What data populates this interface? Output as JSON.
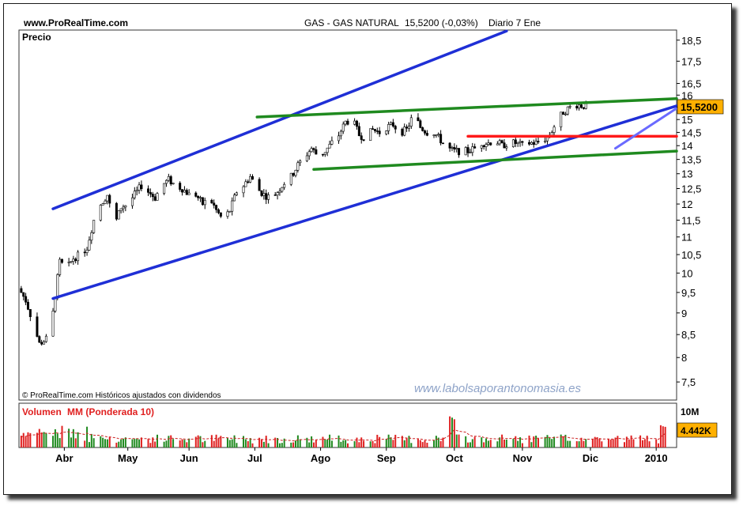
{
  "header": {
    "site": "www.ProRealTime.com",
    "instrument": "GAS - GAS NATURAL",
    "quote": "15,5200 (-0,03%)",
    "period": "Diario  7 Ene"
  },
  "price_panel": {
    "label": "Precio",
    "footer": "© ProRealTime.com  Históricos ajustados con dividendos",
    "watermark": "www.labolsaporantonomasia.es",
    "last_price_badge": "15,5200"
  },
  "volume_panel": {
    "label_volume": "Volumen",
    "label_mm": "MM (Ponderada 10)",
    "scale_max_label": "10M",
    "last_volume_badge": "4.442K"
  },
  "colors": {
    "channel": "#1f2fd6",
    "support_resistance": "#1f8a1f",
    "horizontal_level": "#ff1a1a",
    "short_trend": "#6a6aff",
    "candles": "#000000",
    "volume_up": "#1f8a1f",
    "volume_down": "#e02020",
    "volume_ma": "#cc2222",
    "badge_bg": "#ffb000"
  },
  "chart_data": {
    "type": "line",
    "title": "GAS - GAS NATURAL",
    "x_axis": {
      "labels": [
        "Abr",
        "May",
        "Jun",
        "Jul",
        "Ago",
        "Sep",
        "Oct",
        "Nov",
        "Dic",
        "2010"
      ],
      "label_positions_in_days": [
        5,
        33,
        60,
        89,
        118,
        147,
        177,
        207,
        237,
        266
      ],
      "range_days": [
        -15,
        275
      ]
    },
    "y_axis": {
      "ticks": [
        7.5,
        8,
        8.5,
        9,
        9.5,
        10,
        10.5,
        11,
        11.5,
        12,
        12.5,
        13,
        13.5,
        14,
        14.5,
        15,
        15.5,
        16,
        16.5,
        17.5,
        18.5
      ],
      "tick_labels": [
        "7,5",
        "8",
        "8,5",
        "9",
        "9,5",
        "10",
        "10,5",
        "11",
        "11,5",
        "12",
        "12,5",
        "13",
        "13,5",
        "14",
        "14,5",
        "15",
        "15,5",
        "16",
        "16,5",
        "17,5",
        "18,5"
      ],
      "scale": "log",
      "range": [
        7.15,
        19.0
      ]
    },
    "price_series": {
      "name": "Precio",
      "x_days": [
        -15,
        -12,
        -9,
        -6,
        -3,
        0,
        3,
        6,
        9,
        12,
        15,
        18,
        21,
        24,
        27,
        30,
        33,
        36,
        39,
        42,
        45,
        48,
        51,
        54,
        57,
        60,
        63,
        66,
        69,
        72,
        75,
        78,
        81,
        84,
        87,
        90,
        93,
        96,
        99,
        102,
        105,
        108,
        111,
        114,
        117,
        120,
        123,
        126,
        129,
        132,
        135,
        138,
        141,
        144,
        147,
        150,
        153,
        156,
        159,
        162,
        165,
        168,
        171,
        174,
        177,
        180,
        183,
        186,
        189,
        192,
        195,
        198,
        201,
        204,
        207,
        210,
        213,
        216,
        219,
        222,
        225,
        228,
        231,
        234,
        237,
        240,
        243,
        246,
        249,
        252,
        255,
        258,
        261,
        264,
        267,
        270
      ],
      "close": [
        9.6,
        9.3,
        8.8,
        8.3,
        8.4,
        9.0,
        10.3,
        10.1,
        10.4,
        10.5,
        10.7,
        11.5,
        12.0,
        12.3,
        11.3,
        11.9,
        12.0,
        12.3,
        12.6,
        12.4,
        12.2,
        12.6,
        12.8,
        12.6,
        12.5,
        12.3,
        12.3,
        12.0,
        12.2,
        11.8,
        11.5,
        11.8,
        12.4,
        12.6,
        12.9,
        12.5,
        12.3,
        12.2,
        12.4,
        12.7,
        12.9,
        13.3,
        13.6,
        13.9,
        13.6,
        13.8,
        14.1,
        14.4,
        14.9,
        15.0,
        14.4,
        14.3,
        14.6,
        14.5,
        14.7,
        14.8,
        14.5,
        14.6,
        15.2,
        14.7,
        14.5,
        14.5,
        14.2,
        13.9,
        13.8,
        13.8,
        13.8,
        13.9,
        14.1,
        14.1,
        14.2,
        14.0,
        14.1,
        14.1,
        14.0,
        14.1,
        14.1,
        14.2,
        14.4,
        14.9,
        15.3,
        15.5,
        15.6,
        15.55,
        15.52
      ],
      "note_values": "approximate daily closes read from candlestick chart"
    },
    "trendlines": [
      {
        "name": "canal alcista superior",
        "color": "channel",
        "points": [
          [
            0,
            11.85
          ],
          [
            200,
            18.95
          ]
        ]
      },
      {
        "name": "canal alcista inferior",
        "color": "channel",
        "points": [
          [
            0,
            9.35
          ],
          [
            275,
            15.55
          ]
        ]
      },
      {
        "name": "resistencia verde",
        "color": "support_resistance",
        "points": [
          [
            90,
            15.1
          ],
          [
            275,
            15.85
          ]
        ]
      },
      {
        "name": "soporte verde",
        "color": "support_resistance",
        "points": [
          [
            115,
            13.15
          ],
          [
            275,
            13.8
          ]
        ]
      },
      {
        "name": "nivel horizontal",
        "color": "horizontal_level",
        "points": [
          [
            183,
            14.35
          ],
          [
            275,
            14.35
          ]
        ]
      },
      {
        "name": "tendencia corta",
        "color": "short_trend",
        "points": [
          [
            248,
            13.9
          ],
          [
            275,
            15.45
          ]
        ]
      }
    ],
    "volume_series": {
      "name": "Volumen",
      "ylim": [
        0,
        10
      ],
      "unit": "M",
      "last_value_label": "4.442K"
    }
  }
}
